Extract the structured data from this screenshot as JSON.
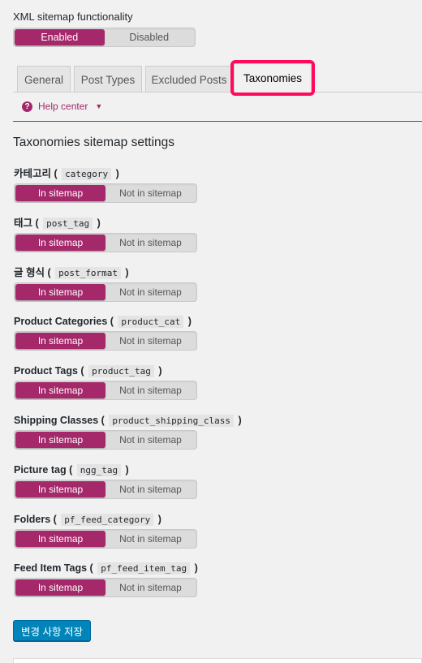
{
  "xml_sitemap": {
    "label": "XML sitemap functionality",
    "options": [
      "Enabled",
      "Disabled"
    ],
    "selected": "Enabled"
  },
  "tabs": [
    {
      "label": "General"
    },
    {
      "label": "Post Types"
    },
    {
      "label": "Excluded Posts"
    },
    {
      "label": "Taxonomies"
    }
  ],
  "active_tab": "Taxonomies",
  "help": {
    "label": "Help center",
    "icon": "question-circle-icon",
    "caret": "▼"
  },
  "section": {
    "title": "Taxonomies sitemap settings"
  },
  "toggle_options": {
    "on": "In sitemap",
    "off": "Not in sitemap"
  },
  "taxonomies": [
    {
      "name": "카테고리",
      "slug": "category",
      "selected": "In sitemap"
    },
    {
      "name": "태그",
      "slug": "post_tag",
      "selected": "In sitemap"
    },
    {
      "name": "글 형식",
      "slug": "post_format",
      "selected": "In sitemap"
    },
    {
      "name": "Product Categories",
      "slug": "product_cat",
      "selected": "In sitemap"
    },
    {
      "name": "Product Tags",
      "slug": "product_tag",
      "selected": "In sitemap"
    },
    {
      "name": "Shipping Classes",
      "slug": "product_shipping_class",
      "selected": "In sitemap"
    },
    {
      "name": "Picture tag",
      "slug": "ngg_tag",
      "selected": "In sitemap"
    },
    {
      "name": "Folders",
      "slug": "pf_feed_category",
      "selected": "In sitemap"
    },
    {
      "name": "Feed Item Tags",
      "slug": "pf_feed_item_tag",
      "selected": "In sitemap"
    }
  ],
  "save_button": {
    "label": "변경 사항 저장"
  },
  "colors": {
    "accent": "#a4286a",
    "highlight": "#ff0a5f",
    "primary_button": "#0085ba"
  }
}
